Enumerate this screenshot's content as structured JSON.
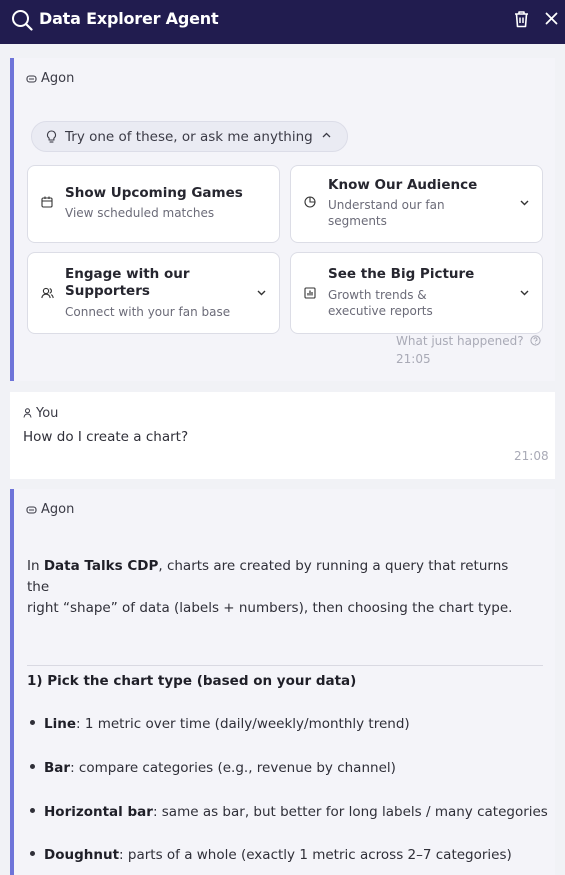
{
  "header": {
    "title": "Data Explorer Agent"
  },
  "welcome": {
    "sender": "Agon",
    "suggest_label": "Try one of these, or ask me anything",
    "options": [
      {
        "title": "Show Upcoming Games",
        "subtitle": "View scheduled matches",
        "icon": "calendar-icon"
      },
      {
        "title": "Know Our Audience",
        "subtitle": "Understand our fan segments",
        "icon": "pie-chart-icon"
      },
      {
        "title": "Engage with our Supporters",
        "subtitle": "Connect with your fan base",
        "icon": "users-icon"
      },
      {
        "title": "See the Big Picture",
        "subtitle": "Growth trends & executive reports",
        "icon": "report-icon"
      }
    ],
    "what_happened": "What just happened?",
    "time": "21:05"
  },
  "user_message": {
    "sender": "You",
    "text": "How do I create a chart?",
    "time": "21:08"
  },
  "reply": {
    "sender": "Agon",
    "intro_bold": "Data Talks CDP",
    "intro_pre": "In ",
    "intro_rest_1": ", charts are created by running a query that returns the",
    "intro_rest_2": "right “shape” of data (labels + numbers), then choosing the chart type.",
    "section_heading": "1) Pick the chart type (based on your data)",
    "bullets": [
      {
        "term": "Line",
        "text": ": 1 metric over time (daily/weekly/monthly trend)"
      },
      {
        "term": "Bar",
        "text": ": compare categories (e.g., revenue by channel)"
      },
      {
        "term": "Horizontal bar",
        "text": ": same as bar, but better for long labels / many categories"
      },
      {
        "term": "Doughnut",
        "text": ": parts of a whole (exactly 1 metric across 2–7 categories)"
      }
    ]
  },
  "colors": {
    "header_bg": "#211c4f",
    "accent": "#6e74d9",
    "panel_bg": "#f1f2f6"
  }
}
